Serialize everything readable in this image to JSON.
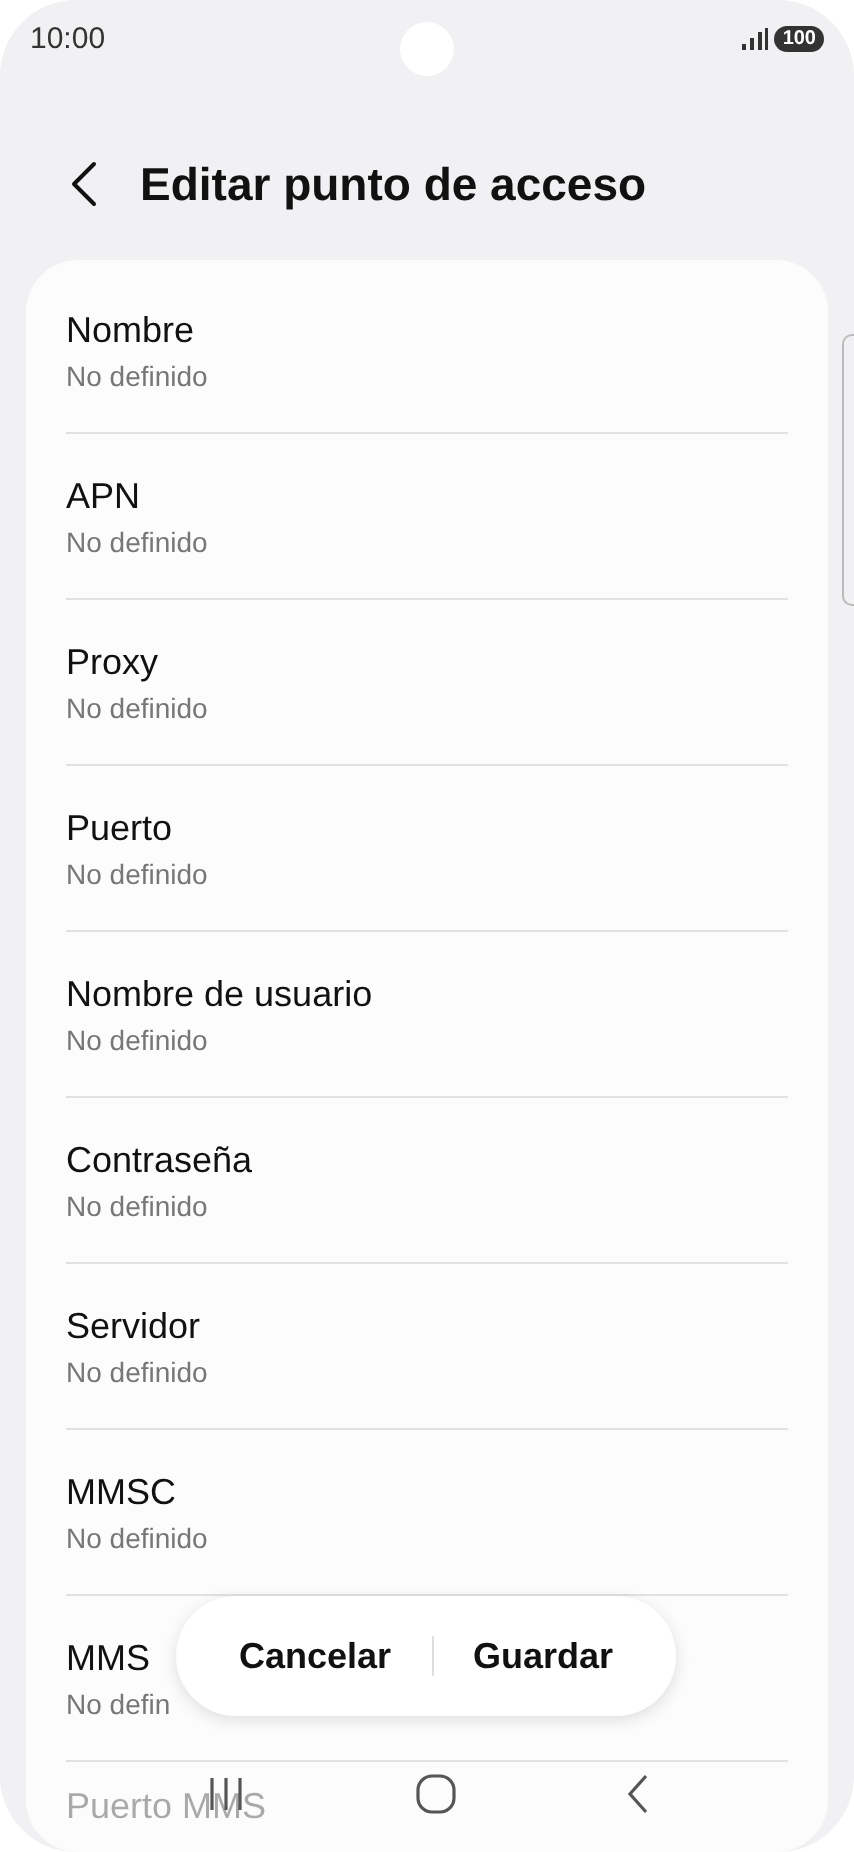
{
  "status_bar": {
    "time": "10:00",
    "battery": "100"
  },
  "header": {
    "title": "Editar punto de acceso"
  },
  "fields": [
    {
      "label": "Nombre",
      "value": "No definido"
    },
    {
      "label": "APN",
      "value": "No definido"
    },
    {
      "label": "Proxy",
      "value": "No definido"
    },
    {
      "label": "Puerto",
      "value": "No definido"
    },
    {
      "label": "Nombre de usuario",
      "value": "No definido"
    },
    {
      "label": "Contraseña",
      "value": "No definido"
    },
    {
      "label": "Servidor",
      "value": "No definido"
    },
    {
      "label": "MMSC",
      "value": "No definido"
    },
    {
      "label": "MMS",
      "value": "No defin"
    },
    {
      "label": "Puerto MMS"
    }
  ],
  "actions": [
    "Cancelar",
    "Guardar"
  ]
}
